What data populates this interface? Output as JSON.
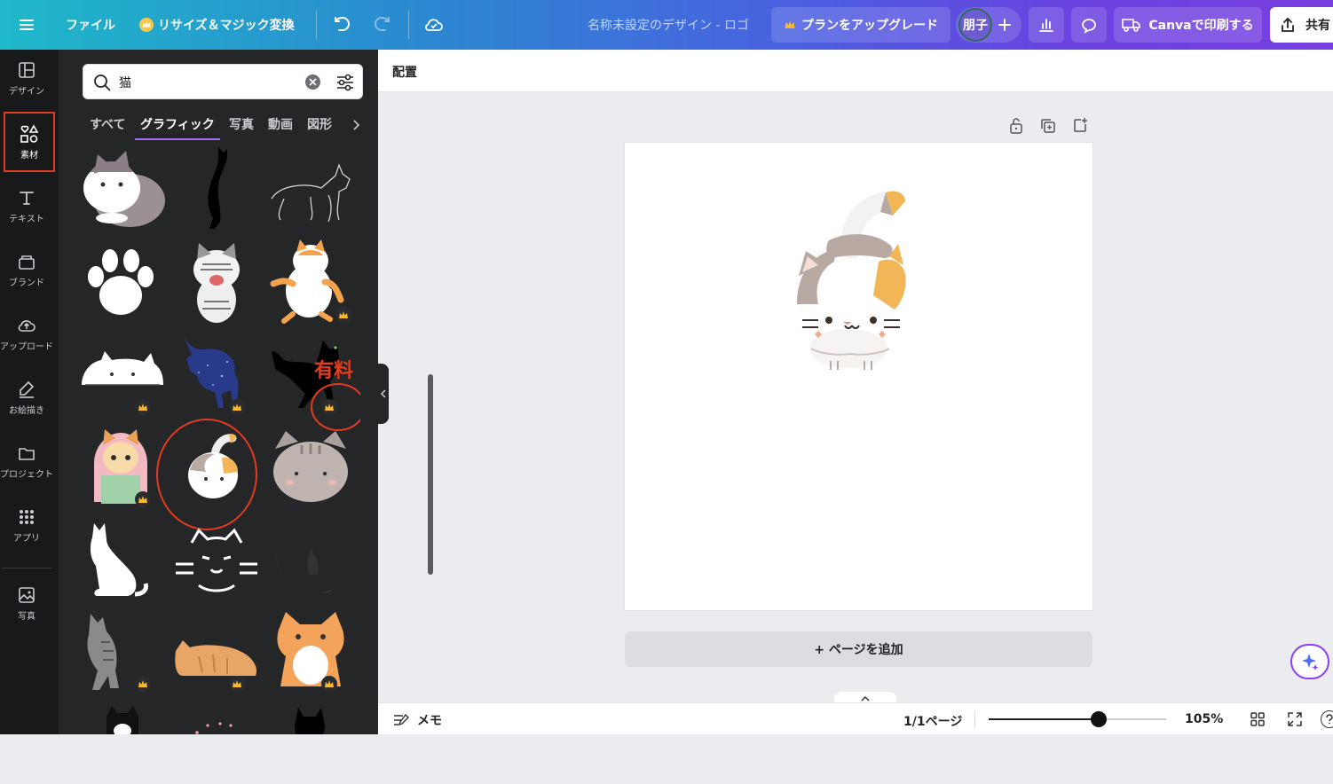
{
  "topbar": {
    "menu_icon": "hamburger-icon",
    "file_label": "ファイル",
    "resize_label": "リサイズ＆マジック変換",
    "design_title": "名称未設定のデザイン - ロゴ",
    "upgrade_label": "プランをアップグレード",
    "avatar_text": "朋子",
    "print_label": "Canvaで印刷する",
    "share_label": "共有"
  },
  "rail": {
    "items": [
      {
        "label": "デザイン",
        "icon": "layout-icon"
      },
      {
        "label": "素材",
        "icon": "elements-icon"
      },
      {
        "label": "テキスト",
        "icon": "text-icon"
      },
      {
        "label": "ブランド",
        "icon": "brand-icon"
      },
      {
        "label": "アップロード",
        "icon": "upload-icon"
      },
      {
        "label": "お絵描き",
        "icon": "draw-icon"
      },
      {
        "label": "プロジェクト",
        "icon": "folder-icon"
      },
      {
        "label": "アプリ",
        "icon": "apps-icon"
      },
      {
        "label": "写真",
        "icon": "photo-icon"
      }
    ]
  },
  "panel": {
    "search_value": "猫",
    "tabs": [
      "すべて",
      "グラフィック",
      "写真",
      "動画",
      "図形"
    ],
    "annotation_label": "有料"
  },
  "canvas": {
    "toolbar_label": "配置",
    "add_page_label": "+ ページを追加"
  },
  "bottombar": {
    "notes_label": "メモ",
    "page_indicator": "1/1ページ",
    "zoom_label": "105%",
    "zoom_value": 0.62
  },
  "colors": {
    "annotation_red": "#e23b1e",
    "accent_purple": "#8b3dff"
  }
}
